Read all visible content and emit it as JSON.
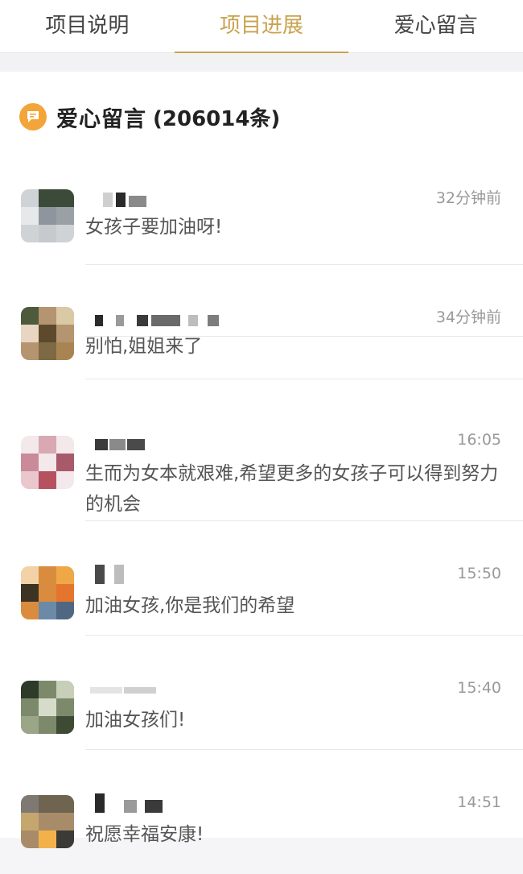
{
  "tabs": [
    {
      "label": "项目说明",
      "active": false
    },
    {
      "label": "项目进展",
      "active": true
    },
    {
      "label": "爱心留言",
      "active": false
    }
  ],
  "section": {
    "title": "爱心留言",
    "count": "(206014条)",
    "icon": "message-icon"
  },
  "comments": [
    {
      "time": "32分钟前",
      "text": "女孩子要加油呀!"
    },
    {
      "time": "34分钟前",
      "text": "别怕,姐姐来了"
    },
    {
      "time": "16:05",
      "text": "生而为女本就艰难,希望更多的女孩子可以得到努力的机会"
    },
    {
      "time": "15:50",
      "text": "加油女孩,你是我们的希望"
    },
    {
      "time": "15:40",
      "text": "加油女孩们!"
    },
    {
      "time": "14:51",
      "text": "祝愿幸福安康!"
    }
  ],
  "colors": {
    "accent": "#c8a24e",
    "icon": "#f3a53a"
  }
}
